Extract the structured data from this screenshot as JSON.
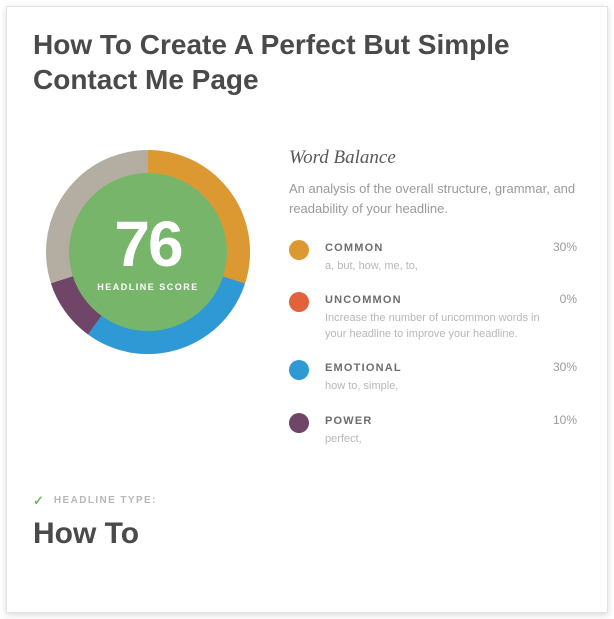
{
  "headline": "How To Create A Perfect But Simple Contact Me Page",
  "score": {
    "value": "76",
    "label": "HEADLINE SCORE"
  },
  "word_balance": {
    "title": "Word Balance",
    "description": "An analysis of the overall structure, grammar, and readability of your headline."
  },
  "categories": [
    {
      "key": "common",
      "name": "COMMON",
      "pct": "30%",
      "detail": "a, but, how, me, to,",
      "color": "#dd9931"
    },
    {
      "key": "uncommon",
      "name": "UNCOMMON",
      "pct": "0%",
      "detail": "Increase the number of uncommon words in your headline to improve your headline.",
      "color": "#e3623e"
    },
    {
      "key": "emotional",
      "name": "EMOTIONAL",
      "pct": "30%",
      "detail": "how to, simple,",
      "color": "#2f99d6"
    },
    {
      "key": "power",
      "name": "POWER",
      "pct": "10%",
      "detail": "perfect,",
      "color": "#6f4568"
    }
  ],
  "headline_type": {
    "label": "HEADLINE TYPE:",
    "value": "How To"
  },
  "chart_data": {
    "type": "donut",
    "title": "Headline Score Word Balance",
    "center_value": 76,
    "center_label": "HEADLINE SCORE",
    "outer_ring_color": "#b4aea2",
    "segments": [
      {
        "name": "COMMON",
        "value": 30,
        "color": "#dd9931"
      },
      {
        "name": "UNCOMMON",
        "value": 0,
        "color": "#e3623e"
      },
      {
        "name": "EMOTIONAL",
        "value": 30,
        "color": "#2f99d6"
      },
      {
        "name": "POWER",
        "value": 10,
        "color": "#6f4568"
      }
    ]
  }
}
